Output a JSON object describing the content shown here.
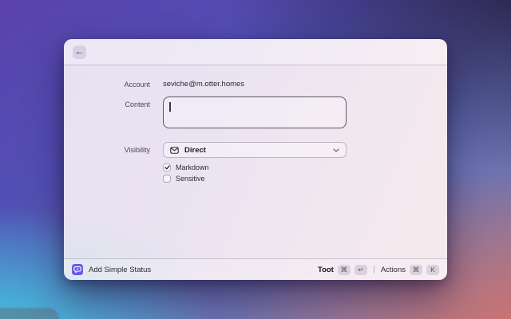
{
  "colors": {
    "accent": "#675CE5",
    "wallpaper_top_left": "#5A42AD",
    "wallpaper_top_right": "#221833",
    "wallpaper_bottom_left": "#3ED5E8",
    "wallpaper_bottom_right": "#D3726A"
  },
  "window": {
    "header": {
      "back_icon": "←"
    },
    "form": {
      "account": {
        "label": "Account",
        "value": "seviche@m.otter.homes"
      },
      "content": {
        "label": "Content",
        "value": ""
      },
      "visibility": {
        "label": "Visibility",
        "value": "Direct"
      },
      "checkboxes": [
        {
          "label": "Markdown",
          "checked": true
        },
        {
          "label": "Sensitive",
          "checked": false
        }
      ]
    },
    "footer": {
      "app_title": "Add Simple Status",
      "primary_action": {
        "label": "Toot",
        "keys": [
          "⌘",
          "↵"
        ]
      },
      "secondary_action": {
        "label": "Actions",
        "keys": [
          "⌘",
          "K"
        ]
      }
    }
  }
}
